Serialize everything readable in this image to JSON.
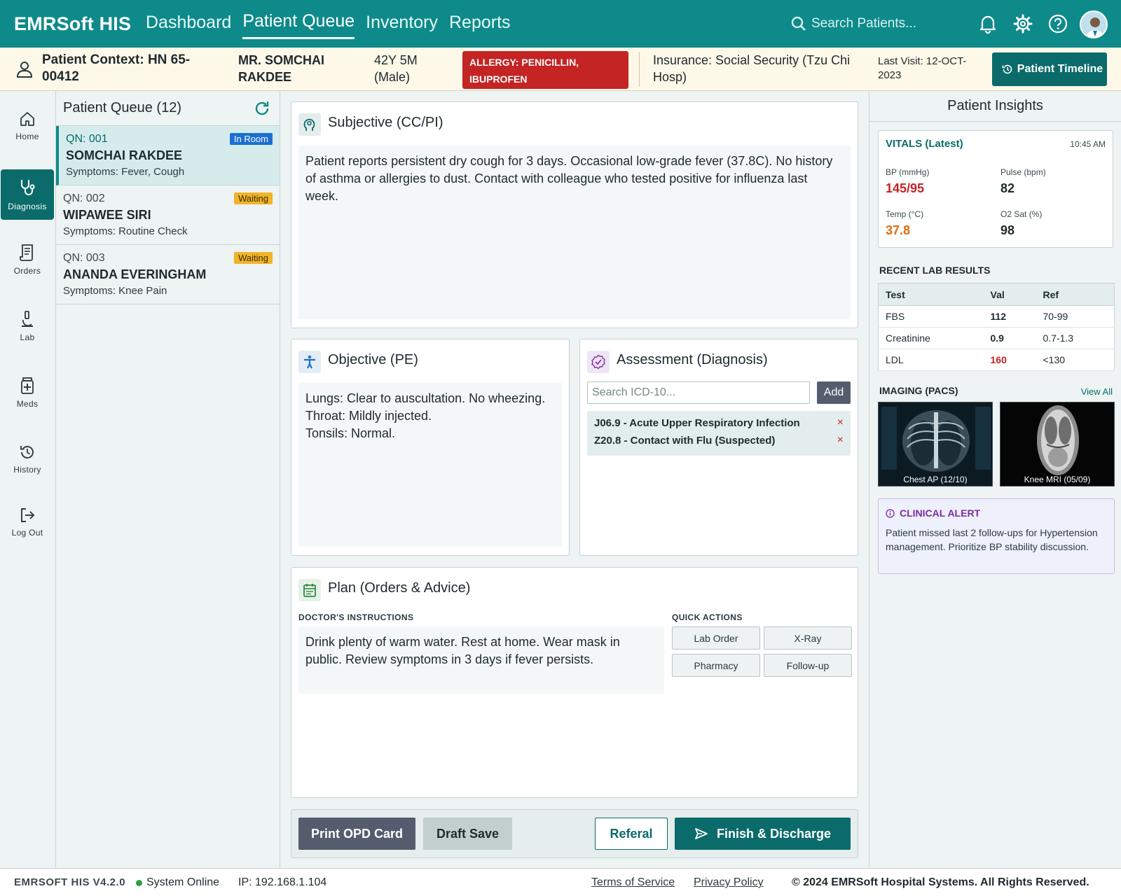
{
  "app": {
    "brand": "EMRSoft HIS"
  },
  "nav": {
    "items": [
      {
        "label": "Dashboard",
        "active": false
      },
      {
        "label": "Patient Queue",
        "active": true
      },
      {
        "label": "Inventory",
        "active": false
      },
      {
        "label": "Reports",
        "active": false
      }
    ],
    "search_placeholder": "Search Patients...",
    "icons": [
      "bell-icon",
      "gear-icon",
      "help-icon",
      "user-avatar"
    ]
  },
  "context": {
    "hn": "Patient Context: HN 65-00412",
    "name": "MR. SOMCHAI RAKDEE",
    "age": "42Y 5M (Male)",
    "allergy": "ALLERGY: PENICILLIN, IBUPROFEN",
    "insurance": "Insurance: Social Security (Tzu Chi Hosp)",
    "last_visit": "Last Visit: 12-OCT-2023",
    "timeline_button": "Patient Timeline"
  },
  "rail": [
    {
      "label": "Home",
      "icon": "home-icon"
    },
    {
      "label": "Diagnosis",
      "icon": "stethoscope-icon",
      "active": true
    },
    {
      "label": "Orders",
      "icon": "orders-icon"
    },
    {
      "label": "Lab",
      "icon": "microscope-icon"
    },
    {
      "label": "Meds",
      "icon": "medicine-icon"
    },
    {
      "label": "History",
      "icon": "history-icon"
    },
    {
      "label": "Log Out",
      "icon": "logout-icon"
    }
  ],
  "queue": {
    "title": "Patient Queue (12)",
    "items": [
      {
        "qn": "QN: 001",
        "name": "SOMCHAI RAKDEE",
        "symptoms": "Symptoms: Fever, Cough",
        "status": "In Room"
      },
      {
        "qn": "QN: 002",
        "name": "WIPAWEE SIRI",
        "symptoms": "Symptoms: Routine Check",
        "status": "Waiting"
      },
      {
        "qn": "QN: 003",
        "name": "ANANDA EVERINGHAM",
        "symptoms": "Symptoms: Knee Pain",
        "status": "Waiting"
      }
    ]
  },
  "subjective": {
    "title": "Subjective (CC/PI)",
    "text": "Patient reports persistent dry cough for 3 days. Occasional low-grade fever (37.8C). No history of asthma or allergies to dust. Contact with colleague who tested positive for influenza last week."
  },
  "objective": {
    "title": "Objective (PE)",
    "lines": [
      "Lungs: Clear to auscultation. No wheezing.",
      "Throat: Mildly injected.",
      "Tonsils: Normal."
    ]
  },
  "assessment": {
    "title": "Assessment (Diagnosis)",
    "search_placeholder": "Search ICD-10...",
    "add_label": "Add",
    "diagnoses": [
      "J06.9 - Acute Upper Respiratory Infection",
      "Z20.8 - Contact with Flu (Suspected)"
    ],
    "remove_glyph": "×"
  },
  "plan": {
    "title": "Plan (Orders & Advice)",
    "instructions_label": "DOCTOR'S INSTRUCTIONS",
    "instructions": "Drink plenty of warm water. Rest at home. Wear mask in public. Review symptoms in 3 days if fever persists.",
    "quick_actions_label": "QUICK ACTIONS",
    "quick_actions": [
      "Lab Order",
      "X-Ray",
      "Pharmacy",
      "Follow-up"
    ]
  },
  "actions": {
    "print": "Print OPD Card",
    "draft": "Draft Save",
    "referal": "Referal",
    "finish": "Finish & Discharge"
  },
  "insights": {
    "title": "Patient Insights",
    "vitals_title": "VITALS (Latest)",
    "vitals_time": "10:45 AM",
    "vitals": [
      {
        "label": "BP (mmHg)",
        "value": "145/95",
        "color": "#c42424"
      },
      {
        "label": "Pulse (bpm)",
        "value": "82",
        "color": "#1e2a2d"
      },
      {
        "label": "Temp (°C)",
        "value": "37.8",
        "color": "#e06a12"
      },
      {
        "label": "O2 Sat (%)",
        "value": "98",
        "color": "#1e2a2d"
      }
    ],
    "labs_title": "RECENT LAB RESULTS",
    "labs_headers": [
      "Test",
      "Val",
      "Ref"
    ],
    "labs": [
      {
        "test": "FBS",
        "val": "112",
        "ref": "70-99",
        "color": "#1e2a2d"
      },
      {
        "test": "Creatinine",
        "val": "0.9",
        "ref": "0.7-1.3",
        "color": "#1e2a2d"
      },
      {
        "test": "LDL",
        "val": "160",
        "ref": "<130",
        "color": "#c42424"
      }
    ],
    "imaging_title": "IMAGING (PACS)",
    "imaging_view_all": "View All",
    "images": [
      "Chest AP (12/10)",
      "Knee MRI (05/09)"
    ],
    "alert_title": "CLINICAL ALERT",
    "alert_text": "Patient missed last 2 follow-ups for Hypertension management. Prioritize BP stability discussion."
  },
  "footer": {
    "version": "EMRSOFT HIS V4.2.0",
    "status": "System Online",
    "ip": "IP: 192.168.1.104",
    "terms": "Terms of Service",
    "privacy": "Privacy Policy",
    "copyright": "© 2024 EMRSoft Hospital Systems. All Rights Reserved."
  },
  "colors": {
    "primary": "#0f8a8a",
    "dark": "#0b6b6b",
    "danger": "#c42424",
    "warning": "#f0b428",
    "online": "#2e9e3e"
  }
}
